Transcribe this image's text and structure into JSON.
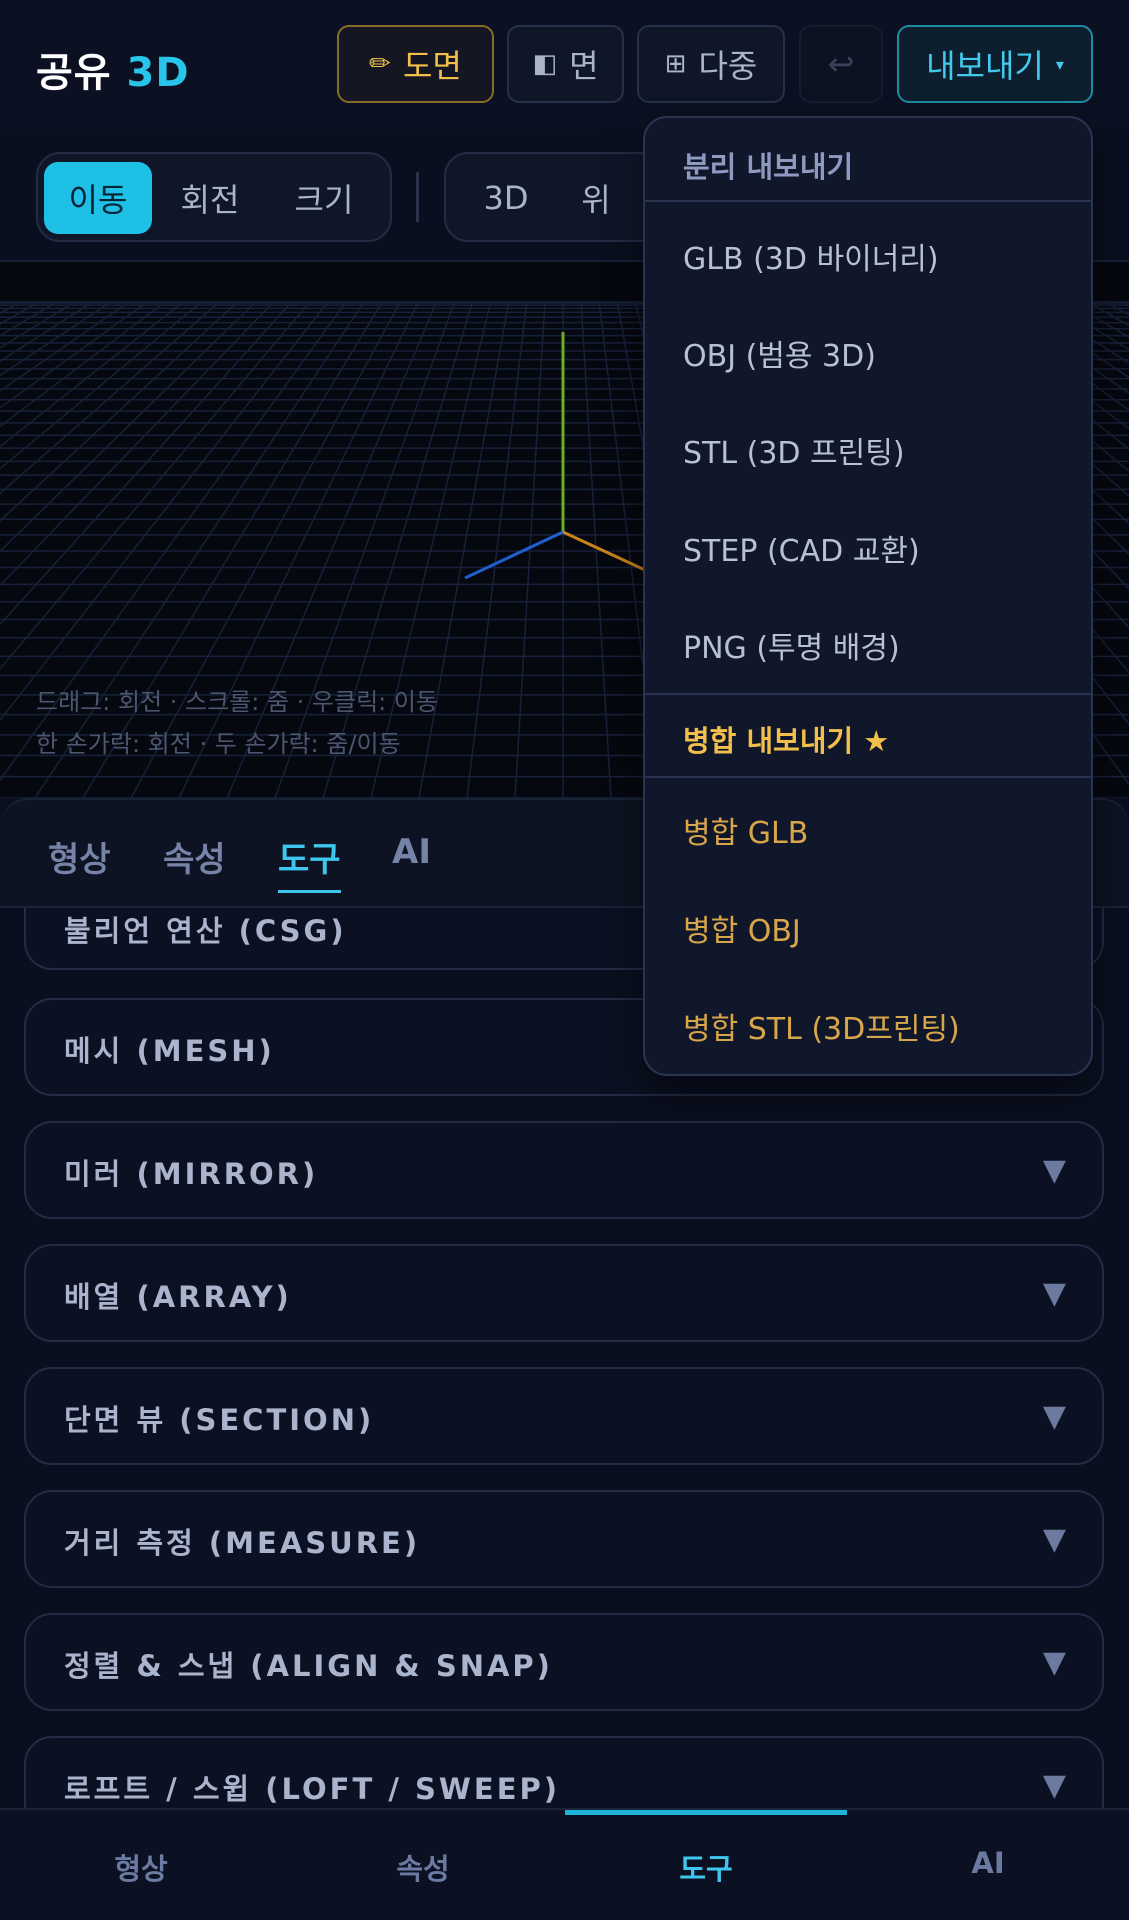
{
  "app": {
    "logo_main": "공유",
    "logo_accent": "3D"
  },
  "topbar": {
    "drawing": {
      "icon": "pencil-icon",
      "label": "도면"
    },
    "face": {
      "icon": "half-square-icon",
      "label": "면"
    },
    "multi": {
      "icon": "grid-icon",
      "label": "다중"
    },
    "undo": {
      "icon": "undo-icon",
      "label": "↩"
    },
    "export": {
      "label": "내보내기",
      "caret": "▾"
    }
  },
  "modes": {
    "items": [
      "이동",
      "회전",
      "크기"
    ],
    "active": 0
  },
  "views": {
    "items": [
      "3D",
      "위"
    ]
  },
  "viewport": {
    "hint_line1": "드래그: 회전 · 스크롤: 줌 · 우클릭: 이동",
    "hint_line2": "한 손가락: 회전 · 두 손가락: 줌/이동"
  },
  "panel_tabs": {
    "items": [
      "형상",
      "속성",
      "도구",
      "AI"
    ],
    "active": 2
  },
  "sections": [
    "불리언 연산 (CSG)",
    "메시 (MESH)",
    "미러 (MIRROR)",
    "배열 (ARRAY)",
    "단면 뷰 (SECTION)",
    "거리 측정 (MEASURE)",
    "정렬 & 스냅 (ALIGN & SNAP)",
    "로프트 / 스윕 (LOFT / SWEEP)"
  ],
  "chevron": "▼",
  "dropdown": {
    "separate_header": "분리 내보내기",
    "separate_items": [
      "GLB (3D 바이너리)",
      "OBJ (범용 3D)",
      "STL (3D 프린팅)",
      "STEP (CAD 교환)",
      "PNG (투명 배경)"
    ],
    "merge_header": "병합 내보내기 ★",
    "merge_items": [
      "병합 GLB",
      "병합 OBJ",
      "병합 STL (3D프린팅)"
    ]
  },
  "bottom_nav": {
    "items": [
      "형상",
      "속성",
      "도구",
      "AI"
    ],
    "active": 2
  },
  "colors": {
    "accent": "#1fc0e6",
    "gold": "#f2c04a",
    "background": "#0a0f1f"
  }
}
